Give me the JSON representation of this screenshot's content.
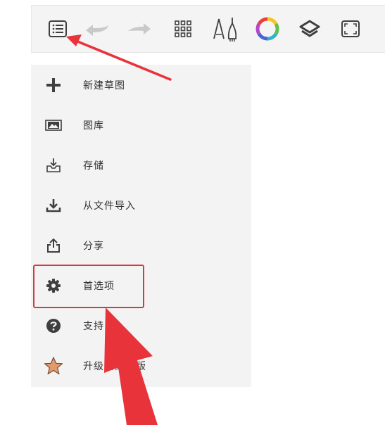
{
  "toolbar": {
    "buttons": [
      {
        "name": "menu-list-icon"
      },
      {
        "name": "undo-arrow-icon"
      },
      {
        "name": "redo-arrow-icon"
      },
      {
        "name": "grid-icon"
      },
      {
        "name": "brush-pen-icon"
      },
      {
        "name": "color-wheel-icon"
      },
      {
        "name": "layers-icon"
      },
      {
        "name": "fullscreen-icon"
      }
    ]
  },
  "menu": {
    "items": [
      {
        "label": "新建草图",
        "icon": "plus-icon"
      },
      {
        "label": "图库",
        "icon": "gallery-icon"
      },
      {
        "label": "存储",
        "icon": "save-icon"
      },
      {
        "label": "从文件导入",
        "icon": "import-icon"
      },
      {
        "label": "分享",
        "icon": "share-icon"
      },
      {
        "label": "首选项",
        "icon": "gear-icon"
      },
      {
        "label": "支持",
        "icon": "help-icon"
      },
      {
        "label": "升级到高级版",
        "icon": "star-icon"
      }
    ]
  },
  "colors": {
    "annotation_red": "#e8333a",
    "star_orange": "#e39a6a",
    "icon_gray": "#3f3f3f"
  }
}
